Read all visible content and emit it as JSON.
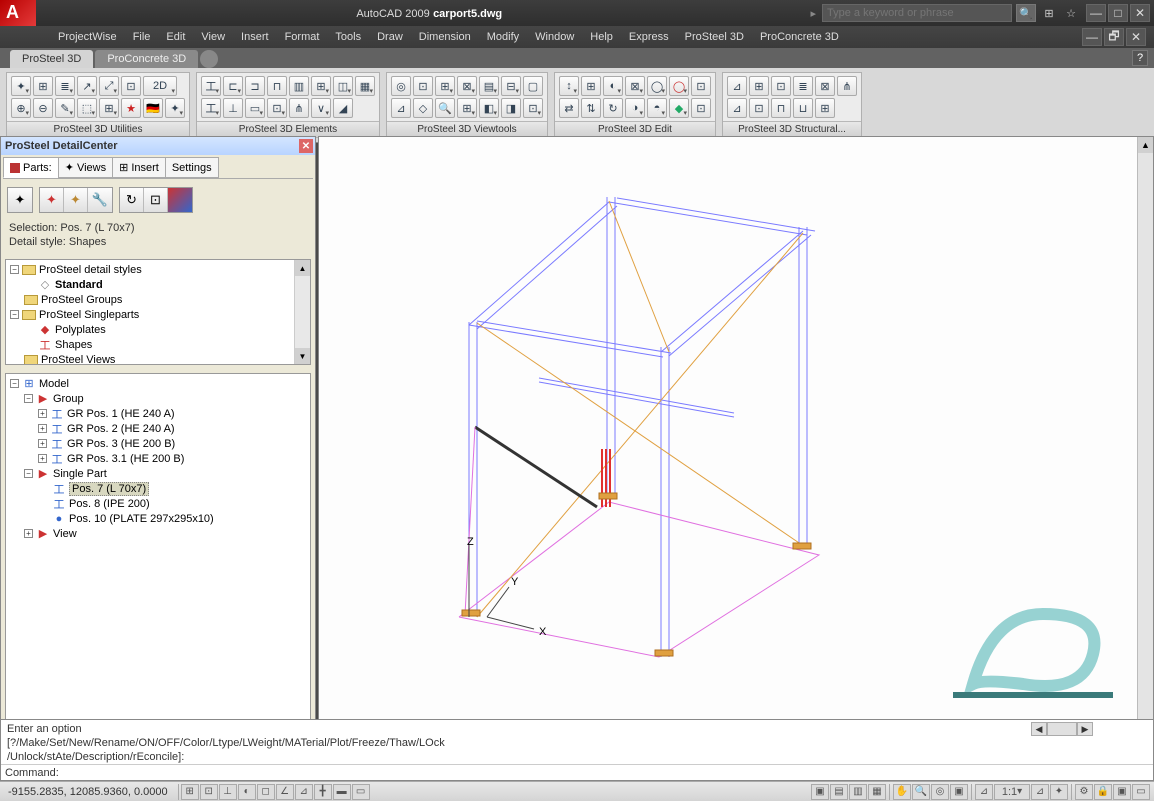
{
  "title": {
    "app": "AutoCAD 2009",
    "file": "carport5.dwg"
  },
  "search": {
    "placeholder": "Type a keyword or phrase"
  },
  "menu": [
    "ProjectWise",
    "File",
    "Edit",
    "View",
    "Insert",
    "Format",
    "Tools",
    "Draw",
    "Dimension",
    "Modify",
    "Window",
    "Help",
    "Express",
    "ProSteel 3D",
    "ProConcrete 3D"
  ],
  "panelTabs": {
    "active": "ProSteel 3D",
    "inactive": "ProConcrete 3D"
  },
  "toolbars": [
    {
      "label": "ProSteel 3D Utilities"
    },
    {
      "label": "ProSteel 3D Elements"
    },
    {
      "label": "ProSteel 3D Viewtools"
    },
    {
      "label": "ProSteel 3D Edit"
    },
    {
      "label": "ProSteel 3D Structural..."
    }
  ],
  "detail": {
    "title": "ProSteel DetailCenter",
    "tabs": [
      "Parts:",
      "Views",
      "Insert",
      "Settings"
    ],
    "selection": "Selection: Pos. 7 (L 70x7)",
    "style": "Detail style: Shapes",
    "tree1": [
      {
        "ind": 0,
        "exp": "-",
        "icon": "folder",
        "label": "ProSteel detail styles"
      },
      {
        "ind": 1,
        "exp": "",
        "icon": "std",
        "label": "Standard",
        "bold": true
      },
      {
        "ind": 0,
        "exp": "",
        "icon": "folder",
        "label": "ProSteel Groups"
      },
      {
        "ind": 0,
        "exp": "-",
        "icon": "folder",
        "label": "ProSteel Singleparts"
      },
      {
        "ind": 1,
        "exp": "",
        "icon": "poly",
        "label": "Polyplates"
      },
      {
        "ind": 1,
        "exp": "",
        "icon": "shape",
        "label": "Shapes"
      },
      {
        "ind": 0,
        "exp": "",
        "icon": "folder",
        "label": "ProSteel Views"
      }
    ],
    "tree2": [
      {
        "ind": 0,
        "exp": "-",
        "icon": "model",
        "label": "Model"
      },
      {
        "ind": 1,
        "exp": "-",
        "icon": "arrow",
        "label": "Group"
      },
      {
        "ind": 2,
        "exp": "+",
        "icon": "ibeam",
        "label": "GR Pos. 1 (HE 240 A)"
      },
      {
        "ind": 2,
        "exp": "+",
        "icon": "ibeam",
        "label": "GR Pos. 2 (HE 240 A)"
      },
      {
        "ind": 2,
        "exp": "+",
        "icon": "ibeam",
        "label": "GR Pos. 3 (HE 200 B)"
      },
      {
        "ind": 2,
        "exp": "+",
        "icon": "ibeam",
        "label": "GR Pos. 3.1 (HE 200 B)"
      },
      {
        "ind": 1,
        "exp": "-",
        "icon": "arrow",
        "label": "Single Part"
      },
      {
        "ind": 2,
        "exp": "",
        "icon": "ibeam",
        "label": "Pos. 7 (L 70x7)",
        "sel": true
      },
      {
        "ind": 2,
        "exp": "",
        "icon": "ibeam",
        "label": "Pos. 8 (IPE 200)"
      },
      {
        "ind": 2,
        "exp": "",
        "icon": "plate",
        "label": "Pos. 10 (PLATE 297x295x10)"
      },
      {
        "ind": 1,
        "exp": "+",
        "icon": "arrow",
        "label": "View"
      }
    ]
  },
  "axes": {
    "x": "X",
    "y": "Y",
    "z": "Z"
  },
  "cmd": {
    "line1": "Enter an option",
    "line2": "[?/Make/Set/New/Rename/ON/OFF/Color/Ltype/LWeight/MATerial/Plot/Freeze/Thaw/LOck",
    "line3": "/Unlock/stAte/Description/rEconcile]:",
    "prompt": "Command:"
  },
  "status": {
    "coords": "-9155.2835, 12085.9360, 0.0000",
    "scale": "1:1",
    "annot": "⌾"
  }
}
